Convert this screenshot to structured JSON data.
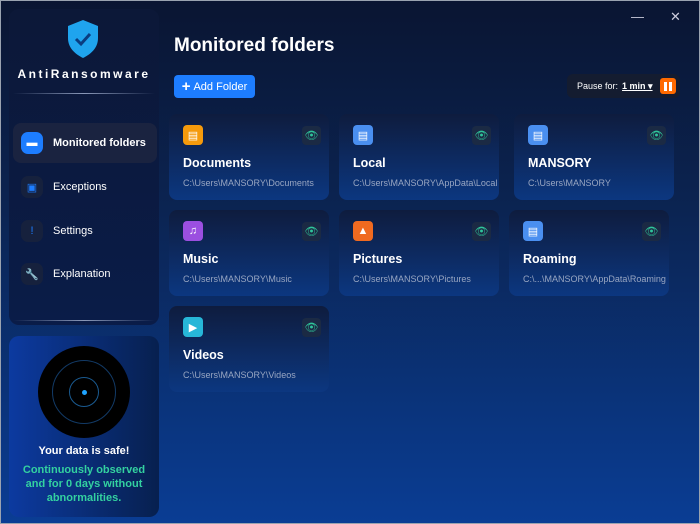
{
  "app": {
    "name": "AntiRansomware",
    "minimize": "—",
    "close": "✕"
  },
  "sidebar": {
    "items": [
      {
        "label": "Monitored folders",
        "icon": "▬"
      },
      {
        "label": "Exceptions",
        "icon": "▣"
      },
      {
        "label": "Settings",
        "icon": "!"
      },
      {
        "label": "Explanation",
        "icon": "🔧"
      }
    ]
  },
  "status": {
    "title": "Your data is safe!",
    "message": "Continuously observed and for 0 days without abnormalities."
  },
  "main": {
    "title": "Monitored folders",
    "add_folder": "Add Folder",
    "add_icon": "+",
    "pause_label": "Pause for:",
    "pause_value": "1 min ▾"
  },
  "folders": [
    {
      "name": "Documents",
      "path": "C:\\Users\\MANSORY\\Documents",
      "icon": "▤",
      "color": "#f59a0c"
    },
    {
      "name": "Local",
      "path": "C:\\Users\\MANSORY\\AppData\\Local",
      "icon": "▤",
      "color": "#4a8ff0"
    },
    {
      "name": "MANSORY",
      "path": "C:\\Users\\MANSORY",
      "icon": "▤",
      "color": "#4a8ff0"
    },
    {
      "name": "Music",
      "path": "C:\\Users\\MANSORY\\Music",
      "icon": "♫",
      "color": "#9b4fe0"
    },
    {
      "name": "Pictures",
      "path": "C:\\Users\\MANSORY\\Pictures",
      "icon": "▲",
      "color": "#f06a20"
    },
    {
      "name": "Roaming",
      "path": "C:\\...\\MANSORY\\AppData\\Roaming",
      "icon": "▤",
      "color": "#4a8ff0"
    },
    {
      "name": "Videos",
      "path": "C:\\Users\\MANSORY\\Videos",
      "icon": "▶",
      "color": "#27b7d8"
    }
  ]
}
